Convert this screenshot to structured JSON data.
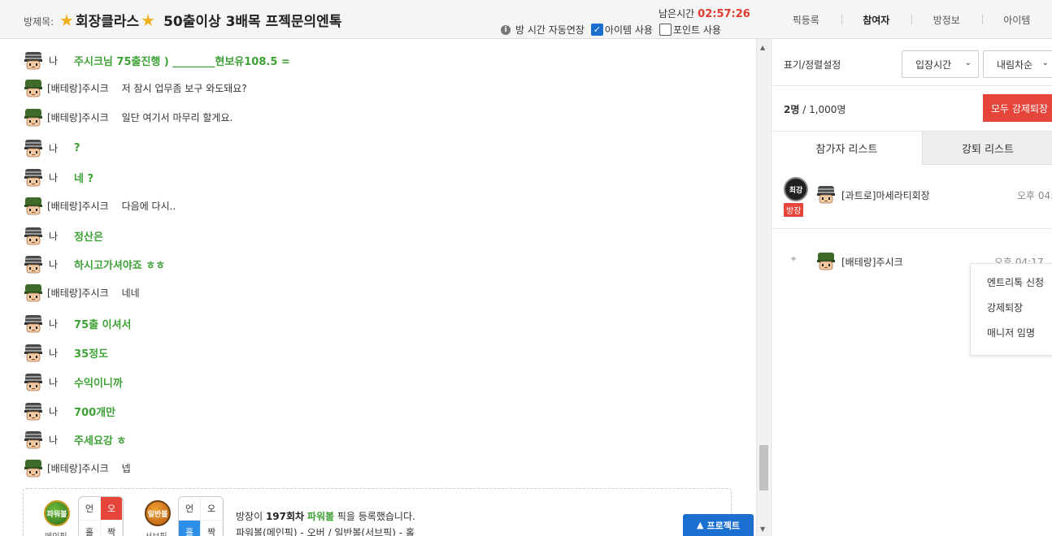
{
  "header": {
    "room_label": "방제목:",
    "room_title_part1": "회장클라스",
    "room_title_part2": "50출이상 3배목 프젝문의엔톡",
    "timer_label": "남은시간",
    "timer_value": "02:57:26",
    "auto_extend": "방 시간 자동연장",
    "item_use": "아이템 사용",
    "item_checked": true,
    "point_use": "포인트 사용",
    "point_checked": false,
    "tabs": [
      "픽등록",
      "참여자",
      "방정보",
      "아이템"
    ],
    "active_tab": "참여자"
  },
  "chat": {
    "messages": [
      {
        "sender": "나",
        "me": true,
        "text": "주시크님 75출진행 ) ________현보유108.5 ="
      },
      {
        "sender": "[배테랑]주시크",
        "me": false,
        "text": "저 잠시 업무좀 보구 와도돼요?"
      },
      {
        "sender": "[배테랑]주시크",
        "me": false,
        "text": "일단 여기서 마무리 할게요."
      },
      {
        "sender": "나",
        "me": true,
        "text": "?"
      },
      {
        "sender": "나",
        "me": true,
        "text": "네 ?"
      },
      {
        "sender": "[배테랑]주시크",
        "me": false,
        "text": "다음에 다시.."
      },
      {
        "sender": "나",
        "me": true,
        "text": "정산은"
      },
      {
        "sender": "나",
        "me": true,
        "text": "하시고가셔야죠 ㅎㅎ"
      },
      {
        "sender": "[배테랑]주시크",
        "me": false,
        "text": "네네"
      },
      {
        "sender": "나",
        "me": true,
        "text": "75출 이셔서"
      },
      {
        "sender": "나",
        "me": true,
        "text": "35정도"
      },
      {
        "sender": "나",
        "me": true,
        "text": "수익이니까"
      },
      {
        "sender": "나",
        "me": true,
        "text": "700개만"
      },
      {
        "sender": "나",
        "me": true,
        "text": "주세요강 ㅎ"
      },
      {
        "sender": "[배테랑]주시크",
        "me": false,
        "text": "넵"
      }
    ]
  },
  "pick": {
    "power_ball_icon": "파워볼",
    "power_ball_caption": "메인픽",
    "normal_ball_icon": "일반볼",
    "normal_ball_caption": "서브픽",
    "power_grid": [
      "언",
      "오",
      "홀",
      "짝"
    ],
    "normal_grid": [
      "언",
      "오",
      "홀",
      "짝"
    ],
    "line1_prefix": "방장이",
    "line1_round": "197회차",
    "line1_game": "파워볼",
    "line1_suffix": "픽을 등록했습니다.",
    "line2": "파워볼(메인픽) - 오버 / 일반볼(서브픽) - 홀"
  },
  "protect_button": "프로젝트",
  "panel": {
    "sort_label": "표기/정렬설정",
    "sort_select": "입장시간",
    "order_select": "내림차순",
    "count_current": "2명",
    "count_total": "/ 1,000명",
    "kick_all": "모두 강제퇴장",
    "tabs": [
      "참가자 리스트",
      "강퇴 리스트"
    ],
    "users": [
      {
        "rank_icon": "최강",
        "badge": "방장",
        "name": "[과트로]마세라티회장",
        "time": "오후 04:"
      },
      {
        "name": "[배테랑]주시크",
        "time": "오후 04:17"
      }
    ],
    "context_menu": [
      "엔트리톡 신청",
      "강제퇴장",
      "매니저 임명"
    ]
  },
  "colors": {
    "accent_red": "#e5453a",
    "accent_blue": "#1a6fd1",
    "my_message_green": "#3da136",
    "timer_red": "#e03b2c"
  }
}
